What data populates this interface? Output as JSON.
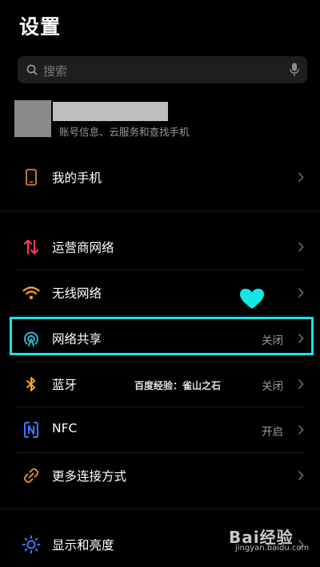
{
  "page_title": "设置",
  "search": {
    "placeholder": "搜索"
  },
  "account": {
    "subtitle": "账号信息、云服务和查找手机"
  },
  "rows": {
    "my_phone": {
      "label": "我的手机",
      "icon": "phone-icon"
    },
    "carrier": {
      "label": "运营商网络",
      "icon": "signal-arrows-icon",
      "color": "#ff3b5c"
    },
    "wifi": {
      "label": "无线网络",
      "icon": "wifi-icon",
      "color": "#ffa41b"
    },
    "hotspot": {
      "label": "网络共享",
      "value": "关闭",
      "icon": "hotspot-icon",
      "color": "#27b8d4"
    },
    "bluetooth": {
      "label": "蓝牙",
      "value": "关闭",
      "icon": "bluetooth-icon",
      "color": "#ffa41b"
    },
    "nfc": {
      "label": "NFC",
      "value": "开启",
      "icon": "nfc-icon",
      "color": "#3a7bff"
    },
    "more_connections": {
      "label": "更多连接方式",
      "icon": "link-icon",
      "color": "#d18a2a"
    },
    "display": {
      "label": "显示和亮度",
      "icon": "sun-icon",
      "color": "#3a7bff"
    }
  },
  "annotations": {
    "highlight_color": "#14e6e6",
    "heart_color": "#14e6e6"
  },
  "watermarks": {
    "author": "百度经验：雀山之石",
    "brand": "Bai经验",
    "url": "jingyan.baidu.com"
  }
}
